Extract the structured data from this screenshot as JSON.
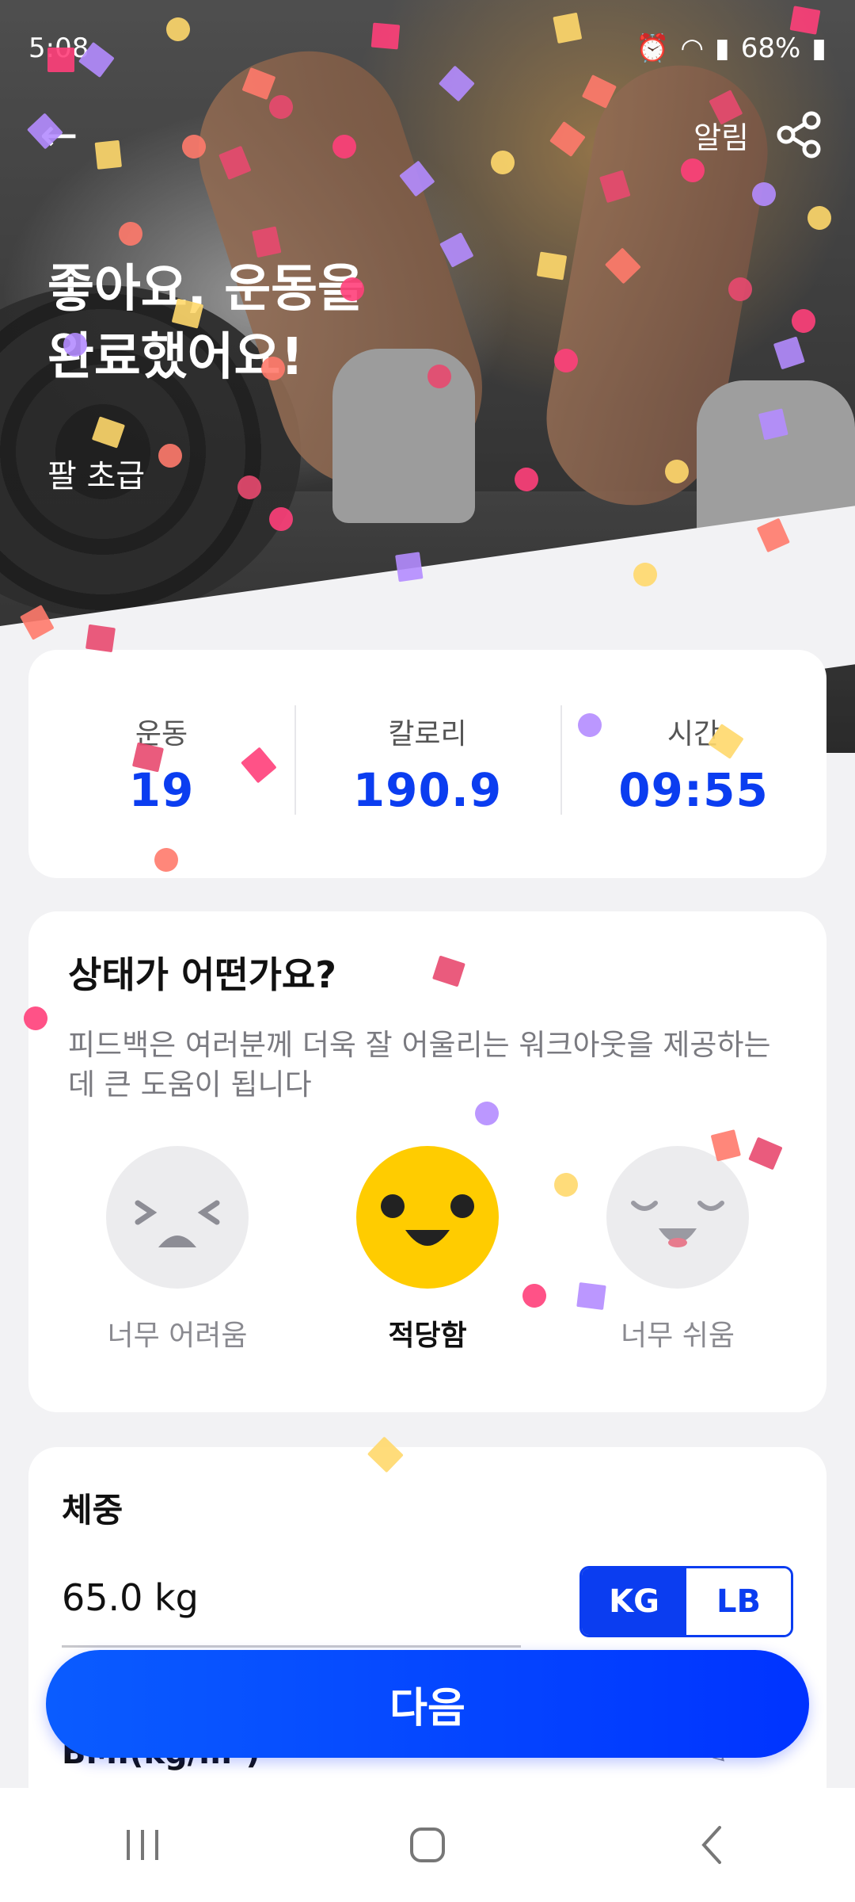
{
  "status_bar": {
    "time": "5:08",
    "battery": "68%"
  },
  "header": {
    "back_icon": "back-arrow-icon",
    "alarm_label": "알림",
    "share_icon": "share-icon"
  },
  "hero": {
    "title_line1": "좋아요, 운동을",
    "title_line2": "완료했어요!",
    "subtitle": "팔 초급"
  },
  "stats": [
    {
      "label": "운동",
      "value": "19"
    },
    {
      "label": "칼로리",
      "value": "190.9"
    },
    {
      "label": "시간",
      "value": "09:55"
    }
  ],
  "feedback": {
    "title": "상태가 어떤가요?",
    "description": "피드백은 여러분께 더욱 잘 어울리는 워크아웃을 제공하는 데 큰 도움이 됩니다",
    "options": [
      {
        "label": "너무 어려움",
        "icon": "too-hard-face-icon",
        "selected": false
      },
      {
        "label": "적당함",
        "icon": "just-right-face-icon",
        "selected": true
      },
      {
        "label": "너무 쉬움",
        "icon": "too-easy-face-icon",
        "selected": false
      }
    ]
  },
  "weight": {
    "title": "체중",
    "value": "65.0 kg",
    "units": {
      "kg": "KG",
      "lb": "LB",
      "selected": "KG"
    },
    "bmi_label": "BMI(kg/m²)"
  },
  "next_button": {
    "label": "다음"
  },
  "colors": {
    "accent": "#0b3df0",
    "selected_face": "#ffcc00"
  }
}
